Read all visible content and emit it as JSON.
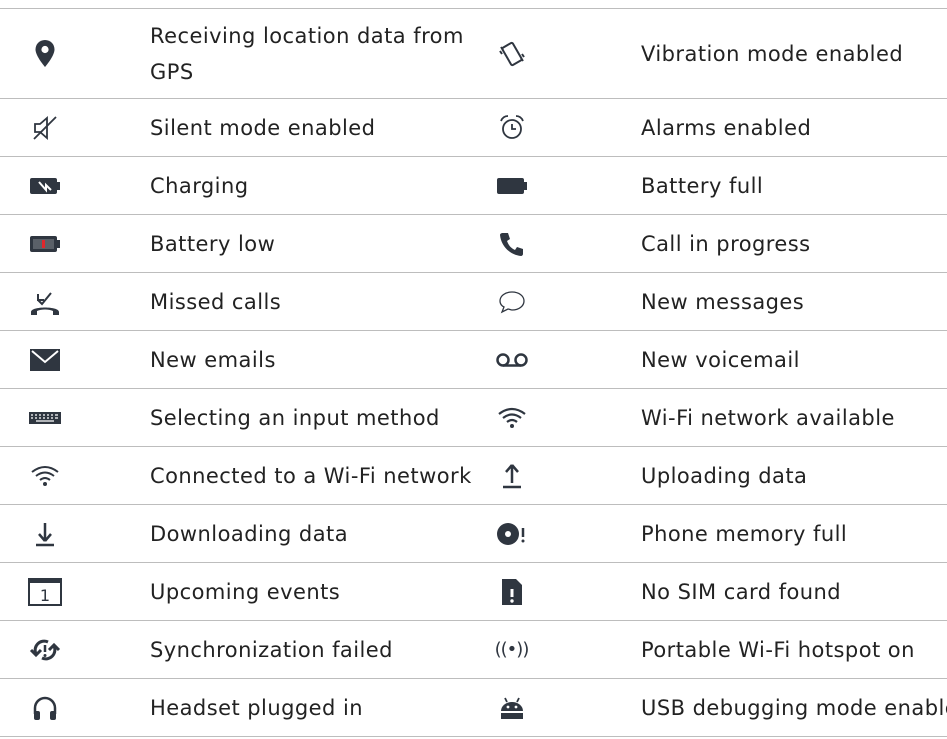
{
  "rows": [
    {
      "left": {
        "icon": "location-pin-icon",
        "label": "Receiving location data from GPS"
      },
      "right": {
        "icon": "vibration-icon",
        "label": "Vibration mode enabled"
      }
    },
    {
      "left": {
        "icon": "silent-mode-icon",
        "label": "Silent mode enabled"
      },
      "right": {
        "icon": "alarm-clock-icon",
        "label": "Alarms enabled"
      }
    },
    {
      "left": {
        "icon": "battery-charging-icon",
        "label": "Charging"
      },
      "right": {
        "icon": "battery-full-icon",
        "label": "Battery full"
      }
    },
    {
      "left": {
        "icon": "battery-low-icon",
        "label": "Battery low"
      },
      "right": {
        "icon": "phone-call-icon",
        "label": "Call in progress"
      }
    },
    {
      "left": {
        "icon": "missed-call-icon",
        "label": "Missed calls"
      },
      "right": {
        "icon": "message-bubble-icon",
        "label": "New messages"
      }
    },
    {
      "left": {
        "icon": "email-envelope-icon",
        "label": "New emails"
      },
      "right": {
        "icon": "voicemail-icon",
        "label": "New voicemail"
      }
    },
    {
      "left": {
        "icon": "keyboard-icon",
        "label": "Selecting an input method"
      },
      "right": {
        "icon": "wifi-available-icon",
        "label": "Wi-Fi network available"
      }
    },
    {
      "left": {
        "icon": "wifi-connected-icon",
        "label": "Connected to a Wi-Fi network"
      },
      "right": {
        "icon": "upload-icon",
        "label": "Uploading data"
      }
    },
    {
      "left": {
        "icon": "download-icon",
        "label": "Downloading data"
      },
      "right": {
        "icon": "memory-full-icon",
        "label": "Phone memory full"
      }
    },
    {
      "left": {
        "icon": "calendar-icon",
        "label": "Upcoming events",
        "icon_text": "1"
      },
      "right": {
        "icon": "no-sim-icon",
        "label": "No SIM card found"
      }
    },
    {
      "left": {
        "icon": "sync-failed-icon",
        "label": "Synchronization failed"
      },
      "right": {
        "icon": "hotspot-icon",
        "label": "Portable Wi-Fi hotspot on",
        "icon_text": "((•))"
      }
    },
    {
      "left": {
        "icon": "headset-icon",
        "label": "Headset plugged in"
      },
      "right": {
        "icon": "android-debug-icon",
        "label": "USB debugging mode enabled"
      }
    }
  ],
  "colors": {
    "icon": "#2f3640",
    "rule": "#bdbdbd",
    "battery_low": "#e0262c"
  }
}
